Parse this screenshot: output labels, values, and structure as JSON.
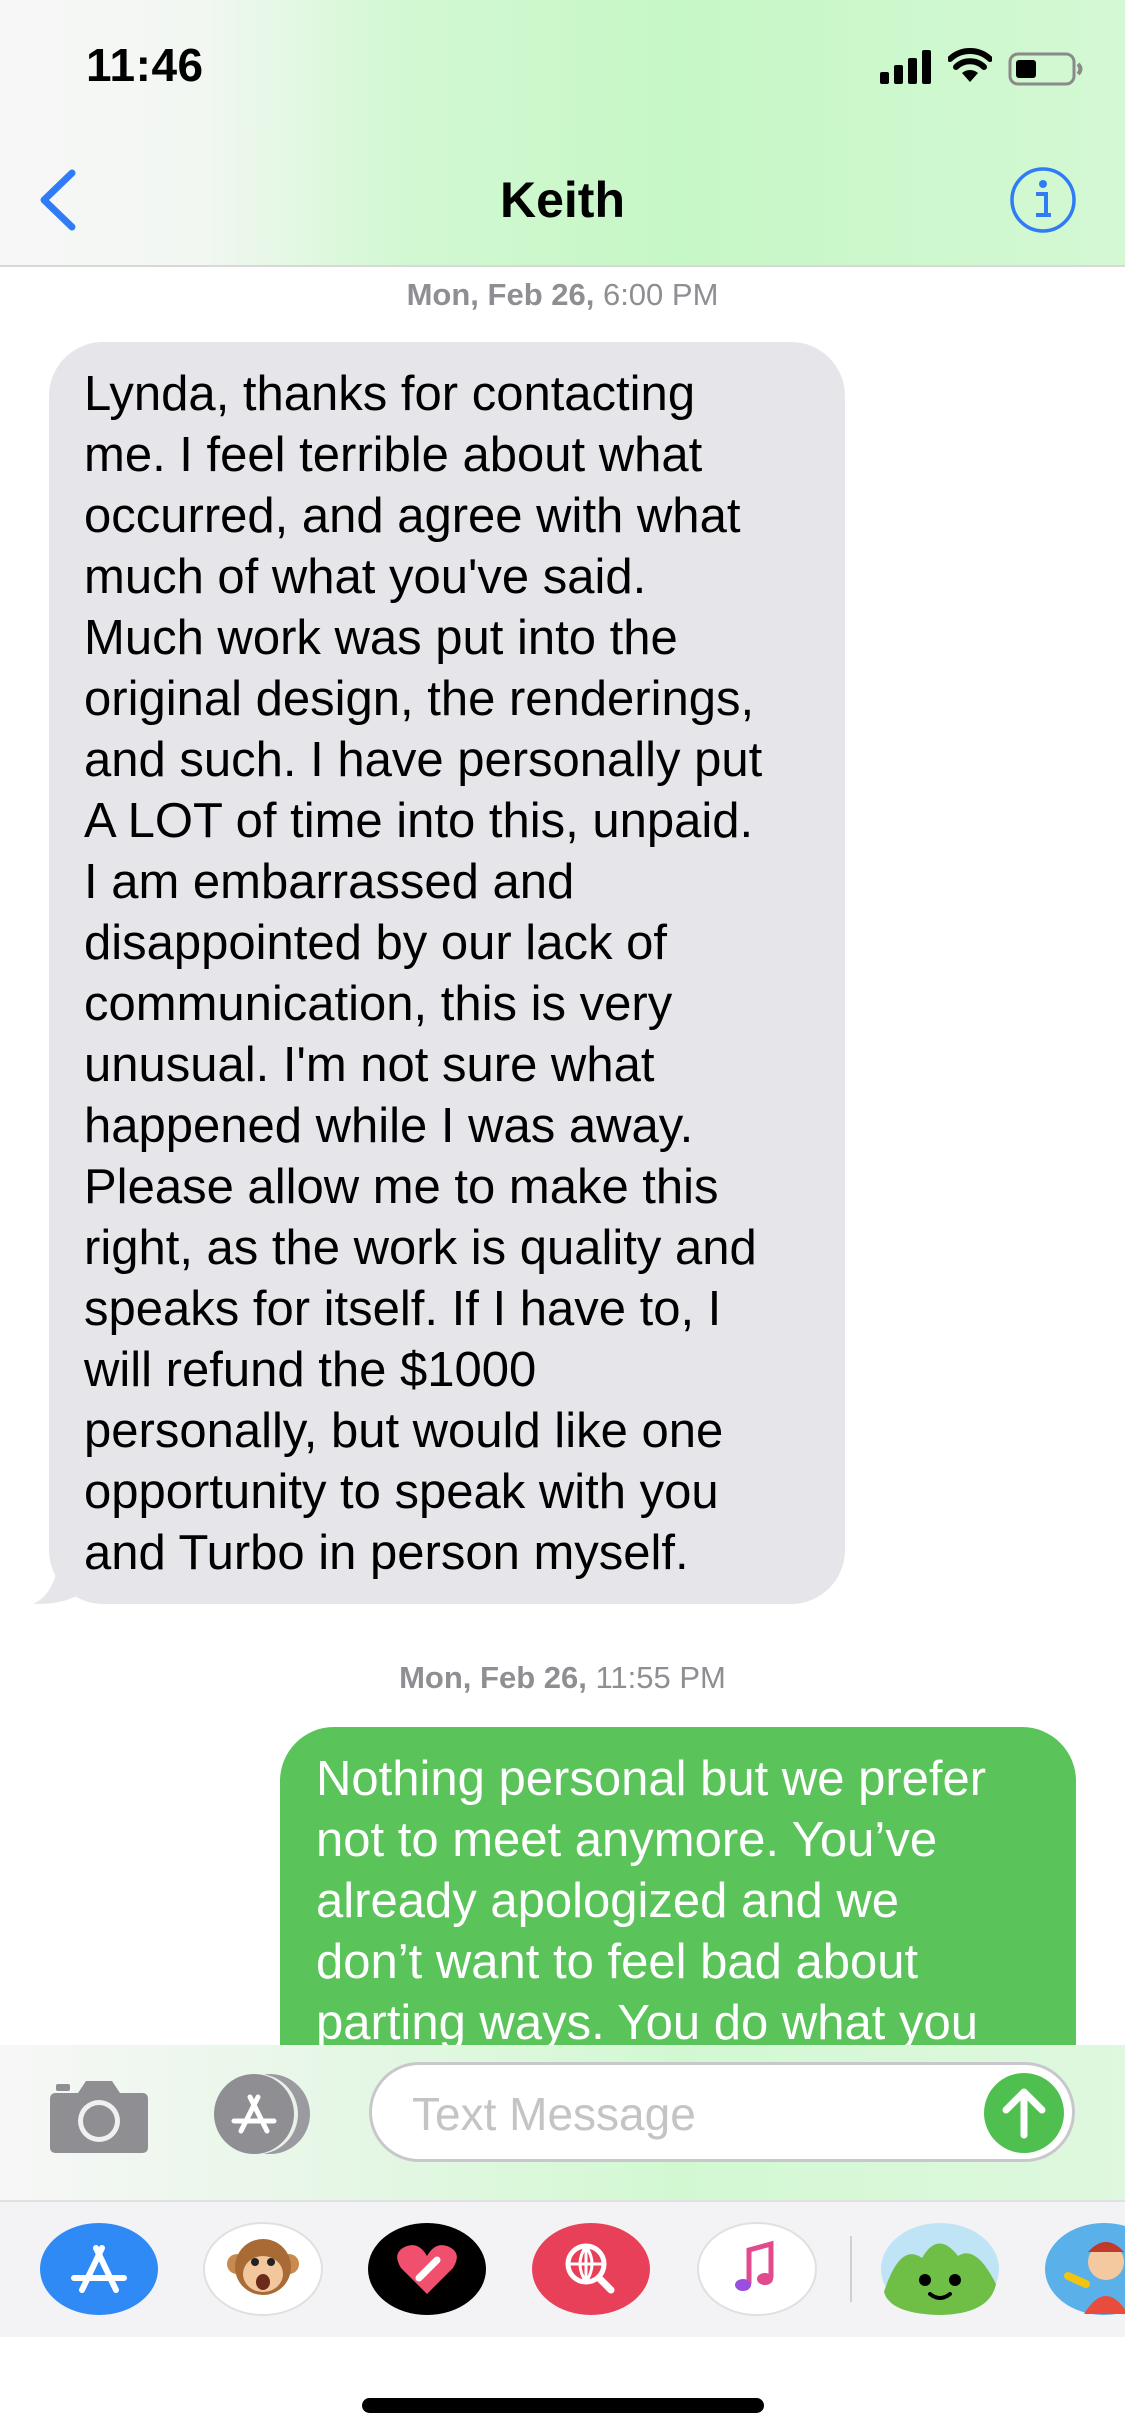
{
  "status_bar": {
    "time": "11:46",
    "icons": [
      "cellular-signal-icon",
      "wifi-icon",
      "battery-icon"
    ]
  },
  "nav": {
    "back_icon": "chevron-left-icon",
    "contact_name": "Keith",
    "info_icon": "info-icon"
  },
  "conversation": {
    "messages": [
      {
        "timestamp_day": "Mon, Feb 26,",
        "timestamp_time": " 6:00 PM",
        "direction": "received",
        "text": "Lynda, thanks for contacting\nme. I feel terrible about what\noccurred, and agree with what\nmuch of what you've said.\nMuch work was put into the\noriginal design, the renderings,\nand such. I have personally put\nA LOT of time into this, unpaid.\nI am embarrassed and\ndisappointed by our lack of\ncommunication, this is very\nunusual. I'm not sure what\nhappened while I was away.\nPlease allow me to make this\nright, as the work is quality and\nspeaks for itself.  If I have to, I\nwill refund the $1000\npersonally, but would like one\nopportunity to speak with you\nand Turbo in person myself."
      },
      {
        "timestamp_day": "Mon, Feb 26,",
        "timestamp_time": " 11:55 PM",
        "direction": "sent",
        "text": "Nothing personal but we prefer\nnot to meet anymore. You’ve\nalready apologized and we\ndon’t want to feel bad about\nparting ways. You do what you"
      }
    ]
  },
  "composer": {
    "camera_icon": "camera-icon",
    "apps_icon": "app-store-icon",
    "placeholder": "Text Message",
    "send_icon": "send-arrow-icon"
  },
  "app_drawer": {
    "apps": [
      "app-store-icon",
      "animoji-monkey-icon",
      "digital-touch-heart-icon",
      "web-search-icon",
      "music-icon",
      "green-monster-app-icon",
      "cartoon-character-app-icon"
    ]
  },
  "colors": {
    "accent_blue": "#2f7cf6",
    "sent_bubble": "#5ac35a",
    "received_bubble": "#e5e5ea",
    "timestamp_gray": "#8e8e93"
  }
}
